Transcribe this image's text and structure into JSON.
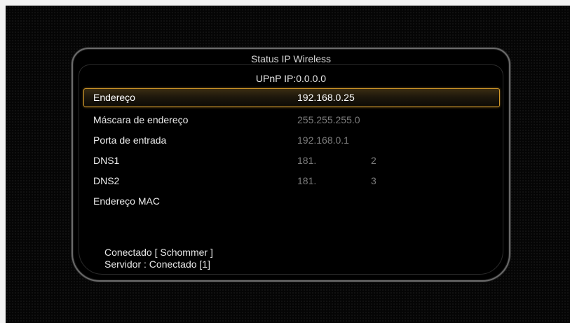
{
  "dialog": {
    "title": "Status IP Wireless",
    "upnp": "UPnP IP:0.0.0.0"
  },
  "rows": [
    {
      "label": "Endereço",
      "value": "192.168.0.25",
      "value2": ""
    },
    {
      "label": "Máscara de endereço",
      "value": "255.255.255.0",
      "value2": ""
    },
    {
      "label": "Porta de entrada",
      "value": "192.168.0.1",
      "value2": ""
    },
    {
      "label": "DNS1",
      "value": "181.",
      "value2": "2"
    },
    {
      "label": "DNS2",
      "value": "181.",
      "value2": "3"
    },
    {
      "label": "Endereço MAC",
      "value": "",
      "value2": ""
    }
  ],
  "status": {
    "connection": "Conectado [ Schommer ]",
    "server": "Servidor : Conectado  [1]"
  },
  "colors": {
    "highlight_border": "#d39a2b",
    "background": "#050505",
    "text": "#ececec",
    "dim_value": "#7c7c7c"
  }
}
